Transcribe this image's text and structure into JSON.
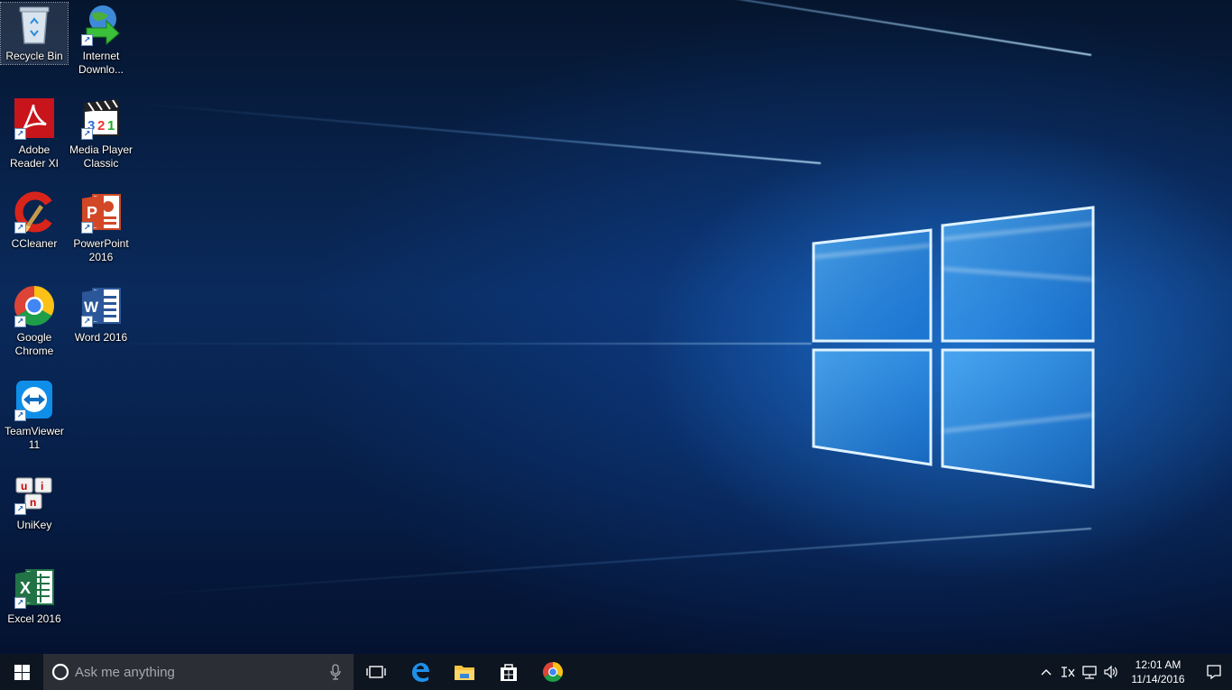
{
  "desktop_icons": [
    {
      "name": "recycle-bin",
      "label": "Recycle Bin",
      "icon": "recycle-bin-icon",
      "selected": true
    },
    {
      "name": "internet-download-manager",
      "label": "Internet Downlo...",
      "icon": "globe-download-icon"
    },
    {
      "name": "adobe-reader",
      "label": "Adobe Reader XI",
      "icon": "adobe-reader-icon"
    },
    {
      "name": "media-player-classic",
      "label": "Media Player Classic",
      "icon": "clapperboard-icon"
    },
    {
      "name": "ccleaner",
      "label": "CCleaner",
      "icon": "ccleaner-icon"
    },
    {
      "name": "powerpoint-2016",
      "label": "PowerPoint 2016",
      "icon": "powerpoint-icon"
    },
    {
      "name": "google-chrome",
      "label": "Google Chrome",
      "icon": "chrome-icon"
    },
    {
      "name": "word-2016",
      "label": "Word 2016",
      "icon": "word-icon"
    },
    {
      "name": "teamviewer-11",
      "label": "TeamViewer 11",
      "icon": "teamviewer-icon"
    },
    {
      "name": "unikey",
      "label": "UniKey",
      "icon": "unikey-icon"
    },
    {
      "name": "excel-2016",
      "label": "Excel 2016",
      "icon": "excel-icon"
    }
  ],
  "taskbar": {
    "search_placeholder": "Ask me anything",
    "pinned": [
      "task-view-icon",
      "edge-icon",
      "file-explorer-icon",
      "store-icon",
      "chrome-icon"
    ],
    "tray": [
      "show-hidden-icons-chevron",
      "keyboard-input-icon",
      "network-icon",
      "volume-icon"
    ],
    "time": "12:01 AM",
    "date": "11/14/2016"
  },
  "colors": {
    "taskbar_bg": "#0c1520",
    "search_bg": "#2b2f35",
    "accent": "#1e90ff"
  }
}
